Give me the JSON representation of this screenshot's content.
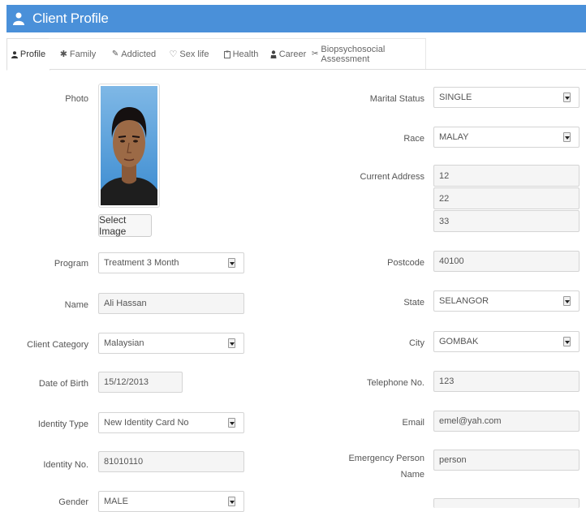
{
  "header": {
    "title": "Client Profile",
    "icon": "user-icon"
  },
  "tabs": [
    {
      "label": "Profile",
      "icon": "user-icon"
    },
    {
      "label": "Family",
      "icon": "asterisk-icon"
    },
    {
      "label": "Addicted",
      "icon": "pencil-icon"
    },
    {
      "label": "Sex life",
      "icon": "heart-icon"
    },
    {
      "label": "Health",
      "icon": "clipboard-icon"
    },
    {
      "label": "Career",
      "icon": "person-icon"
    },
    {
      "label": "Biopsychosocial Assessment",
      "icon": "tools-icon"
    }
  ],
  "left": {
    "photo_label": "Photo",
    "select_image": "Select Image",
    "program": {
      "label": "Program",
      "value": "Treatment 3 Month"
    },
    "name": {
      "label": "Name",
      "value": "Ali Hassan"
    },
    "client_category": {
      "label": "Client Category",
      "value": "Malaysian"
    },
    "dob": {
      "label": "Date of Birth",
      "value": "15/12/2013"
    },
    "identity_type": {
      "label": "Identity Type",
      "value": "New Identity Card No"
    },
    "identity_no": {
      "label": "Identity No.",
      "value": "81010110"
    },
    "gender": {
      "label": "Gender",
      "value": "MALE"
    }
  },
  "right": {
    "marital_status": {
      "label": "Marital Status",
      "value": "SINGLE"
    },
    "race": {
      "label": "Race",
      "value": "MALAY"
    },
    "address": {
      "label": "Current Address",
      "line1": "12",
      "line2": "22",
      "line3": "33"
    },
    "postcode": {
      "label": "Postcode",
      "value": "40100"
    },
    "state": {
      "label": "State",
      "value": "SELANGOR"
    },
    "city": {
      "label": "City",
      "value": "GOMBAK"
    },
    "telephone": {
      "label": "Telephone No.",
      "value": "123"
    },
    "email": {
      "label": "Email",
      "value": "emel@yah.com"
    },
    "emergency": {
      "label_line1": "Emergency Person",
      "label_line2": "Name",
      "value": "person"
    }
  },
  "colors": {
    "header_bg": "#4a90d9",
    "field_bg": "#f5f5f5",
    "border": "#d4d4d4"
  }
}
